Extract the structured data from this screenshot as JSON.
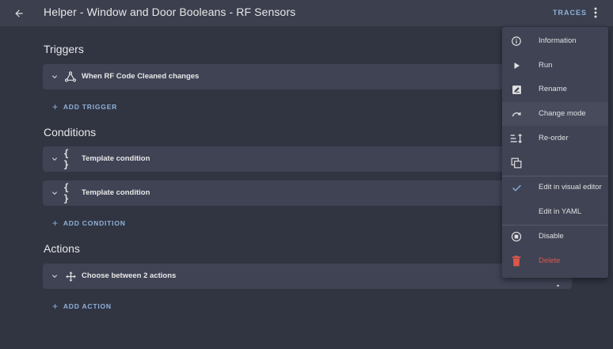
{
  "header": {
    "title": "Helper - Window and Door Booleans - RF Sensors",
    "traces_label": "TRACES"
  },
  "triggers": {
    "title": "Triggers",
    "items": [
      {
        "label": "When RF Code Cleaned changes",
        "icon": "hub-icon"
      }
    ],
    "add_label": "ADD TRIGGER"
  },
  "conditions": {
    "title": "Conditions",
    "items": [
      {
        "label": "Template condition",
        "icon": "code-braces-icon"
      },
      {
        "label": "Template condition",
        "icon": "code-braces-icon"
      }
    ],
    "add_label": "ADD CONDITION"
  },
  "actions": {
    "title": "Actions",
    "items": [
      {
        "label": "Choose between 2 actions",
        "icon": "arrow-all-icon"
      }
    ],
    "add_label": "ADD ACTION"
  },
  "menu": {
    "items": [
      {
        "label": "Information",
        "icon": "information-icon"
      },
      {
        "label": "Run",
        "icon": "play-icon"
      },
      {
        "label": "Rename",
        "icon": "rename-icon"
      },
      {
        "label": "Change mode",
        "icon": "redo-icon"
      },
      {
        "label": "Re-order",
        "icon": "sort-icon"
      },
      {
        "label": "",
        "icon": "duplicate-icon"
      },
      {
        "label": "Edit in visual editor",
        "icon": "check-icon"
      },
      {
        "label": "Edit in YAML",
        "icon": ""
      },
      {
        "label": "Disable",
        "icon": "stop-circle-icon"
      },
      {
        "label": "Delete",
        "icon": "delete-icon"
      }
    ]
  },
  "colors": {
    "background": "#313542",
    "header": "#3b3f4e",
    "card": "#3f4354",
    "accent": "#8fb1d9",
    "danger": "#e0564b",
    "check": "#8fb1d9"
  }
}
